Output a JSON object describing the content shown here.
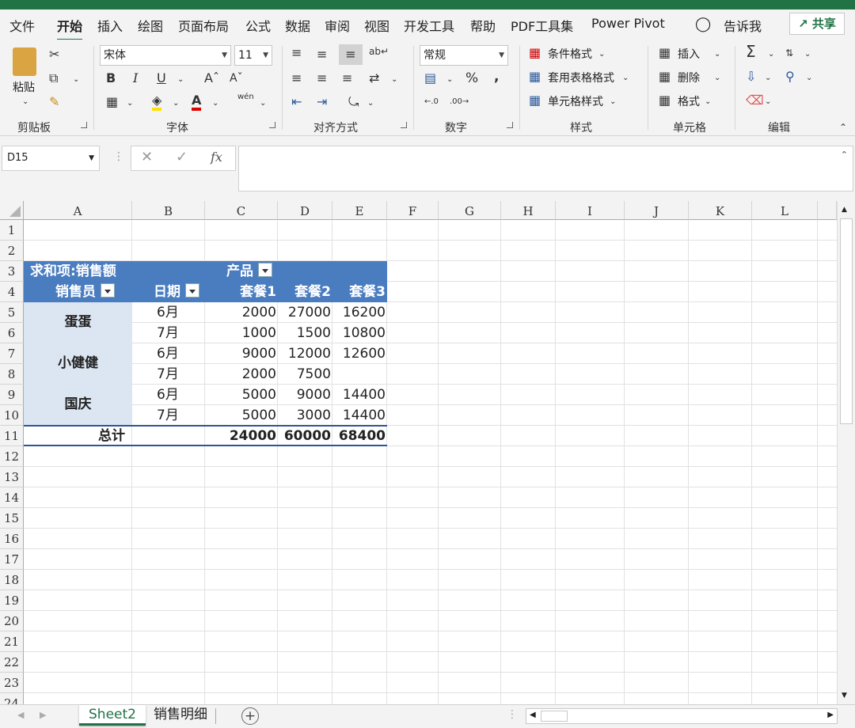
{
  "ribbon_tabs": [
    "文件",
    "开始",
    "插入",
    "绘图",
    "页面布局",
    "公式",
    "数据",
    "审阅",
    "视图",
    "开发工具",
    "帮助",
    "PDF工具集",
    "Power Pivot"
  ],
  "tell_me": "告诉我",
  "share": "共享",
  "clipboard": {
    "paste": "粘贴",
    "label": "剪贴板"
  },
  "font": {
    "name": "宋体",
    "size": "11",
    "label": "字体",
    "bold": "B",
    "italic": "I",
    "underline": "U",
    "phonetic": "wén"
  },
  "alignment": {
    "label": "对齐方式"
  },
  "number": {
    "format": "常规",
    "label": "数字",
    "percent": "%",
    "comma": ","
  },
  "styles": {
    "conditional": "条件格式",
    "table": "套用表格格式",
    "cell": "单元格样式",
    "label": "样式"
  },
  "cells": {
    "insert": "插入",
    "delete": "删除",
    "format": "格式",
    "label": "单元格"
  },
  "editing": {
    "label": "编辑"
  },
  "formula_bar": {
    "name_box": "D15",
    "fx": "fx",
    "value": ""
  },
  "columns": [
    "A",
    "B",
    "C",
    "D",
    "E",
    "F",
    "G",
    "H",
    "I",
    "J",
    "K",
    "L"
  ],
  "rows": [
    "1",
    "2",
    "3",
    "4",
    "5",
    "6",
    "7",
    "8",
    "9",
    "10",
    "11",
    "12",
    "13",
    "14",
    "15",
    "16",
    "17",
    "18",
    "19",
    "20",
    "21",
    "22",
    "23",
    "24"
  ],
  "pivot": {
    "values_label": "求和项:销售额",
    "product_label": "产品",
    "salesperson_label": "销售员",
    "date_label": "日期",
    "products": [
      "套餐1",
      "套餐2",
      "套餐3"
    ],
    "people": [
      "蛋蛋",
      "小健健",
      "国庆"
    ],
    "data": [
      {
        "month": "6月",
        "values": [
          "2000",
          "27000",
          "16200"
        ]
      },
      {
        "month": "7月",
        "values": [
          "1000",
          "1500",
          "10800"
        ]
      },
      {
        "month": "6月",
        "values": [
          "9000",
          "12000",
          "12600"
        ]
      },
      {
        "month": "7月",
        "values": [
          "2000",
          "7500",
          ""
        ]
      },
      {
        "month": "6月",
        "values": [
          "5000",
          "9000",
          "14400"
        ]
      },
      {
        "month": "7月",
        "values": [
          "5000",
          "3000",
          "14400"
        ]
      }
    ],
    "total_label": "总计",
    "totals": [
      "24000",
      "60000",
      "68400"
    ]
  },
  "sheets": [
    "Sheet2",
    "销售明细"
  ],
  "colors": {
    "excel_green": "#217346",
    "pivot_header": "#4a7cc0",
    "pivot_row_fill": "#dce6f2"
  }
}
